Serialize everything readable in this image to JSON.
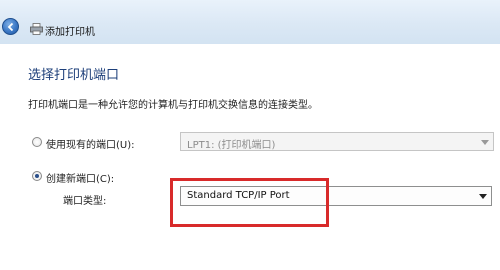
{
  "titlebar": {
    "title": "添加打印机"
  },
  "page": {
    "heading": "选择打印机端口",
    "description": "打印机端口是一种允许您的计算机与打印机交换信息的连接类型。"
  },
  "existing_port": {
    "label": "使用现有的端口(U):",
    "selected": false,
    "combo_value": "LPT1: (打印机端口)"
  },
  "new_port": {
    "label": "创建新端口(C):",
    "selected": true,
    "type_label": "端口类型:",
    "combo_value": "Standard TCP/IP Port"
  },
  "colors": {
    "heading": "#1d3f7a",
    "highlight": "#d82a2a"
  }
}
